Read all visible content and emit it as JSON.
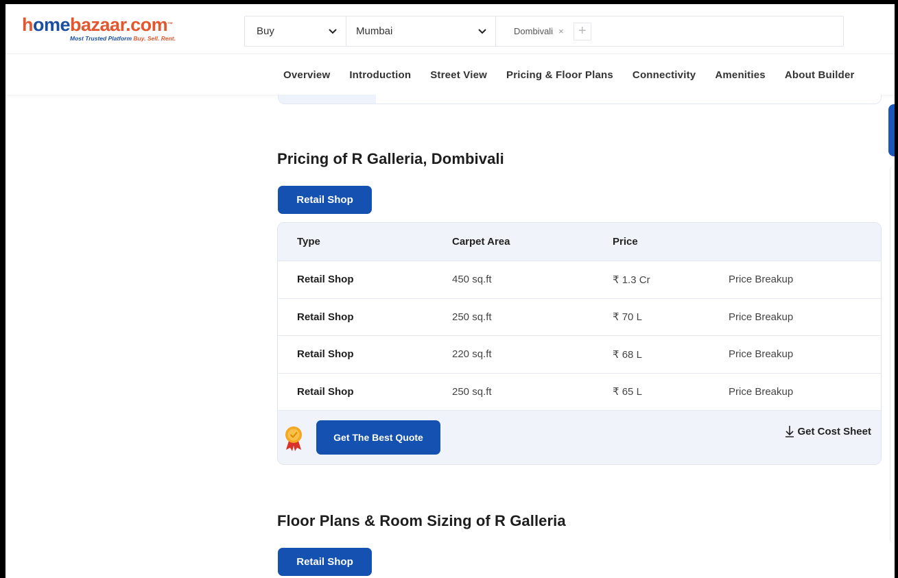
{
  "header": {
    "logo": {
      "part1": "h",
      "part2": "ome",
      "part3": "bazaar.com",
      "tm": "™",
      "tagline_main": "Most Trusted Platform",
      "tagline_accent": "Buy. Sell. Rent."
    },
    "search": {
      "mode": "Buy",
      "city": "Mumbai",
      "locality": "Dombivali",
      "remove_glyph": "×",
      "add_glyph": "+"
    }
  },
  "nav": {
    "items": [
      "Overview",
      "Introduction",
      "Street View",
      "Pricing & Floor Plans",
      "Connectivity",
      "Amenities",
      "About Builder"
    ]
  },
  "pricing": {
    "title": "Pricing of R Galleria, Dombivali",
    "tab": "Retail Shop",
    "columns": [
      "Type",
      "Carpet Area",
      "Price"
    ],
    "rows": [
      {
        "type": "Retail Shop",
        "area": "450 sq.ft",
        "price": "₹ 1.3 Cr",
        "link": "Price Breakup"
      },
      {
        "type": "Retail Shop",
        "area": "250 sq.ft",
        "price": "₹ 70 L",
        "link": "Price Breakup"
      },
      {
        "type": "Retail Shop",
        "area": "220 sq.ft",
        "price": "₹ 68 L",
        "link": "Price Breakup"
      },
      {
        "type": "Retail Shop",
        "area": "250 sq.ft",
        "price": "₹ 65 L",
        "link": "Price Breakup"
      }
    ],
    "quote_button": "Get The Best Quote",
    "cost_sheet": "Get Cost Sheet"
  },
  "floorplans": {
    "title": "Floor Plans & Room Sizing of R Galleria",
    "tab": "Retail Shop"
  },
  "colors": {
    "primary": "#1451b0",
    "logo_orange": "#e4572e",
    "logo_blue": "#1a4fa0"
  }
}
